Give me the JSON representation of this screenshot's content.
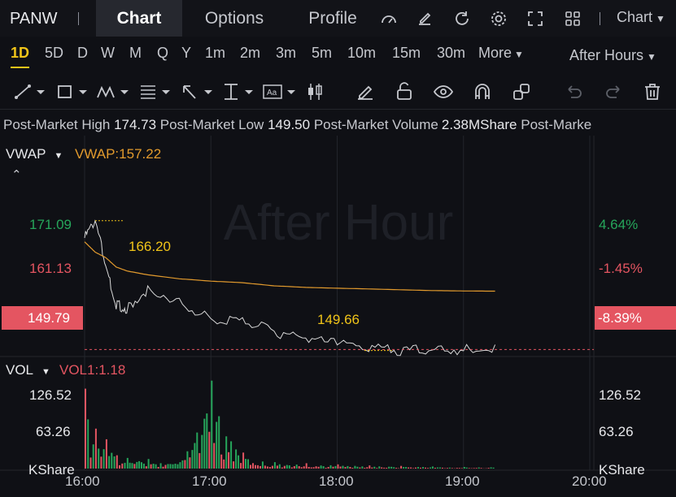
{
  "topbar": {
    "ticker": "PANW",
    "tabs": [
      "Chart",
      "Options",
      "Profile"
    ],
    "active_tab": "Chart",
    "chart_menu": "Chart"
  },
  "periods": {
    "items": [
      "1D",
      "5D",
      "D",
      "W",
      "M",
      "Q",
      "Y",
      "1m",
      "2m",
      "3m",
      "5m",
      "10m",
      "15m",
      "30m",
      "More"
    ],
    "active": "1D",
    "session": "After Hours"
  },
  "info": {
    "high_label": "Post-Market High",
    "high_value": "174.73",
    "low_label": "Post-Market Low",
    "low_value": "149.50",
    "volume_label": "Post-Market Volume",
    "volume_value": "2.38MShare",
    "trailing": "Post-Marke"
  },
  "price_panel": {
    "indicator": "VWAP",
    "vwap_label": "VWAP:157.22",
    "watermark": "After Hour",
    "left_ticks": [
      "171.09",
      "161.13"
    ],
    "right_ticks": [
      "4.64%",
      "-1.45%"
    ],
    "current_price": "149.79",
    "current_pct": "-8.39%",
    "high_marker": "166.20",
    "low_marker": "149.66"
  },
  "vol_panel": {
    "indicator": "VOL",
    "vol_label": "VOL1:1.18",
    "left_ticks": [
      "126.52",
      "63.26",
      "KShare"
    ],
    "right_ticks": [
      "126.52",
      "63.26",
      "KShare"
    ]
  },
  "time_axis": [
    "16:00",
    "17:00",
    "18:00",
    "19:00",
    "20:00"
  ],
  "colors": {
    "up": "#26a65b",
    "down": "#e45561",
    "vwap": "#e29a2d",
    "accent": "#f0c419",
    "price_line": "#d9d9d9"
  },
  "chart_data": [
    {
      "type": "line",
      "x": [
        "16:00",
        "16:05",
        "16:10",
        "16:15",
        "16:20",
        "16:30",
        "16:45",
        "17:00",
        "17:15",
        "17:30",
        "17:45",
        "18:00",
        "18:15",
        "18:30",
        "18:45",
        "19:00",
        "19:15"
      ],
      "series": [
        {
          "name": "Price",
          "values": [
            164.0,
            166.2,
            160.5,
            155.5,
            155.0,
            157.5,
            156.0,
            153.5,
            153.5,
            152.0,
            151.0,
            150.5,
            149.9,
            149.7,
            149.8,
            149.8,
            149.8
          ]
        },
        {
          "name": "VWAP",
          "values": [
            163.5,
            162.2,
            161.5,
            160.3,
            159.8,
            159.3,
            158.8,
            158.5,
            158.3,
            157.9,
            157.7,
            157.6,
            157.5,
            157.4,
            157.3,
            157.25,
            157.22
          ]
        }
      ],
      "ylim": [
        149.0,
        176.0
      ]
    },
    {
      "type": "bar",
      "x": [
        "16:00",
        "16:05",
        "16:10",
        "16:15",
        "16:20",
        "16:30",
        "16:45",
        "17:00",
        "17:15",
        "17:30",
        "17:45",
        "18:00",
        "18:15",
        "18:30",
        "18:45",
        "19:00",
        "19:15"
      ],
      "values": [
        150,
        75,
        55,
        25,
        20,
        18,
        12,
        165,
        30,
        12,
        10,
        8,
        6,
        5,
        4,
        3,
        3
      ],
      "ylim": [
        0,
        160
      ]
    }
  ]
}
